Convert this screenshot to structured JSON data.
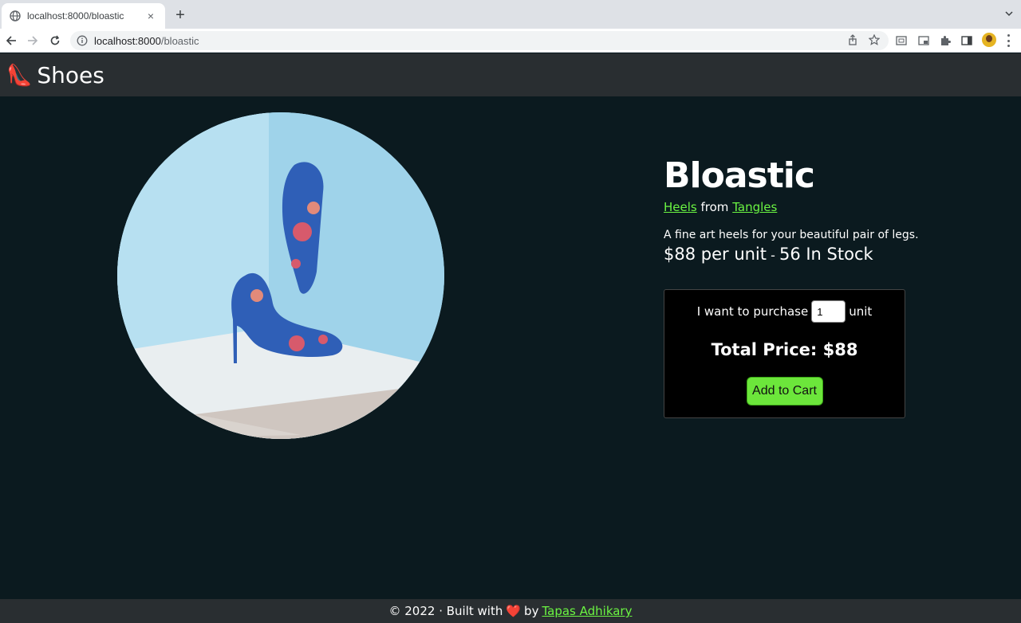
{
  "browser": {
    "tab_title": "localhost:8000/bloastic",
    "new_tab": "+",
    "close": "×",
    "url_host": "localhost:8000",
    "url_path": "/bloastic"
  },
  "site": {
    "logo_emoji": "👠",
    "logo_text": "Shoes"
  },
  "product": {
    "title": "Bloastic",
    "category": "Heels",
    "from_word": "from",
    "brand": "Tangles",
    "description": "A fine art heels for your beautiful pair of legs.",
    "price": "$88 per unit",
    "separator": " - ",
    "stock": "56 In Stock"
  },
  "purchase": {
    "prefix": "I want to purchase",
    "quantity": "1",
    "suffix": "unit",
    "total": "Total Price: $88",
    "add_button": "Add to Cart"
  },
  "footer": {
    "prefix": "© 2022 · Built with",
    "heart": "❤️",
    "by": "by",
    "author": "Tapas Adhikary"
  },
  "colors": {
    "accent": "#6bf542",
    "background": "#0b1a1f",
    "header": "#292e31",
    "button": "#6ce63b"
  }
}
